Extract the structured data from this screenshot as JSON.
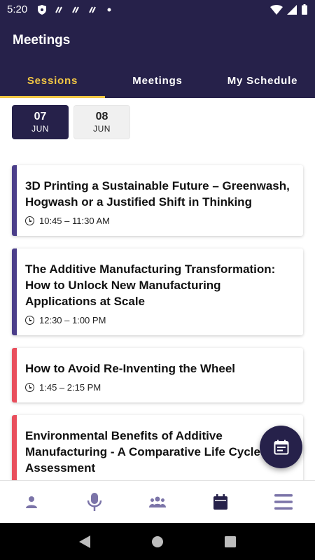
{
  "status_bar": {
    "time": "5:20"
  },
  "app": {
    "title": "Meetings"
  },
  "tabs": [
    {
      "label": "Sessions",
      "active": true
    },
    {
      "label": "Meetings",
      "active": false
    },
    {
      "label": "My Schedule",
      "active": false
    }
  ],
  "dates": [
    {
      "day": "07",
      "month": "JUN",
      "selected": true
    },
    {
      "day": "08",
      "month": "JUN",
      "selected": false
    }
  ],
  "sessions": [
    {
      "title": "3D Printing a Sustainable Future – Greenwash, Hogwash or a Justified Shift in Thinking",
      "time": "10:45 – 11:30 AM",
      "accent": "#4b3e8a"
    },
    {
      "title": "The Additive Manufacturing Transformation: How to Unlock New Manufacturing Applications at Scale",
      "time": "12:30 – 1:00 PM",
      "accent": "#4b3e8a"
    },
    {
      "title": "How to Avoid Re-Inventing the Wheel",
      "time": "1:45 – 2:15 PM",
      "accent": "#e94e5c"
    },
    {
      "title": "Environmental Benefits of Additive Manufacturing - A Comparative Life Cycle Assessment",
      "time": "",
      "accent": "#e94e5c"
    }
  ],
  "bottom_nav": [
    {
      "icon": "person-icon"
    },
    {
      "icon": "microphone-icon"
    },
    {
      "icon": "group-icon"
    },
    {
      "icon": "calendar-icon"
    },
    {
      "icon": "menu-icon"
    }
  ],
  "colors": {
    "primary": "#26214a",
    "tab_active": "#f2c744",
    "accent_purple": "#4b3e8a",
    "accent_red": "#e94e5c",
    "nav_icon": "#7b74a8"
  }
}
